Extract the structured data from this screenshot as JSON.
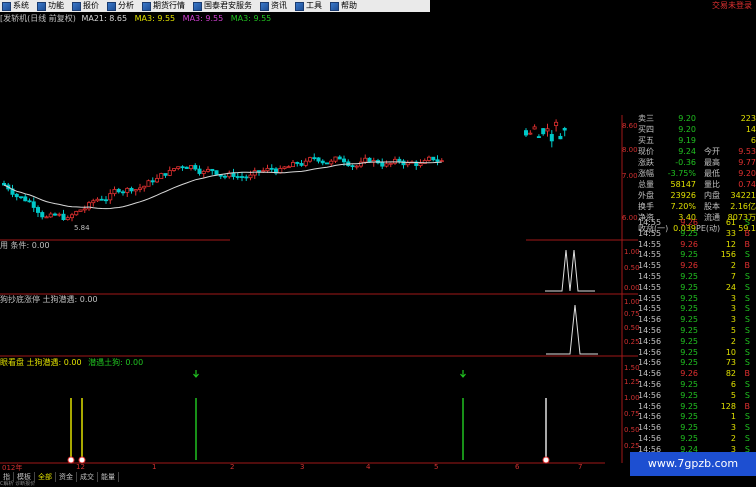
{
  "menu": [
    "系统",
    "功能",
    "报价",
    "分析",
    "期货行情",
    "国泰君安服务",
    "资讯",
    "工具",
    "帮助"
  ],
  "top_right_text": "交易未登录",
  "main_panel": {
    "title": "[发轿机(日线 前复权)",
    "ma21": "MA21: 8.65",
    "ma3a": "MA3: 9.55",
    "ma3b": "MA3: 9.55",
    "ma3c": "MA3: 9.55",
    "low_label": "5.84",
    "yticks": [
      "8.60",
      "8.00",
      "7.00",
      "6.00"
    ]
  },
  "ind1": {
    "label": "用  条件: 0.00",
    "yticks": [
      "1.00",
      "0.50",
      "0.00"
    ]
  },
  "ind2": {
    "label": "狗抄底涨停  土狗潜遇: 0.00",
    "yticks": [
      "1.00",
      "0.75",
      "0.50",
      "0.25"
    ]
  },
  "ind3": {
    "label_a": "眼看盘  土狗潜遇: 0.00",
    "label_b": "潜遇土狗: 0.00",
    "yticks": [
      "1.50",
      "1.25",
      "1.00",
      "0.75",
      "0.50",
      "0.25"
    ]
  },
  "xaxis": [
    "012年",
    "12",
    "1",
    "2",
    "3",
    "4",
    "5",
    "6",
    "7"
  ],
  "quote": [
    {
      "l": "卖三",
      "v": "9.20",
      "r": "223"
    },
    {
      "l": "买四",
      "v": "9.20",
      "r": "14"
    },
    {
      "l": "买五",
      "v": "9.19",
      "r": "6"
    },
    {
      "l": "现价",
      "v": "9.24",
      "l2": "今开",
      "v2": "9.53"
    },
    {
      "l": "涨跌",
      "v": "-0.36",
      "l2": "最高",
      "v2": "9.77"
    },
    {
      "l": "涨幅",
      "v": "-3.75%",
      "l2": "最低",
      "v2": "9.20"
    },
    {
      "l": "总量",
      "v": "58147",
      "l2": "量比",
      "v2": "0.74"
    },
    {
      "l": "外盘",
      "v": "23926",
      "l2": "内盘",
      "v2": "34221"
    },
    {
      "l": "换手",
      "v": "7.20%",
      "l2": "股本",
      "v2": "2.16亿"
    },
    {
      "l": "净资",
      "v": "3.40",
      "l2": "流通",
      "v2": "8073万"
    },
    {
      "l": "收益(一)",
      "v": "0.039",
      "l2": "PE(动)",
      "v2": "59.1"
    }
  ],
  "ticks": [
    {
      "t": "14:55",
      "p": "9.26",
      "v": "61",
      "d": "S"
    },
    {
      "t": "14:55",
      "p": "9.25",
      "v": "33",
      "d": "B"
    },
    {
      "t": "14:55",
      "p": "9.26",
      "v": "12",
      "d": "B"
    },
    {
      "t": "14:55",
      "p": "9.25",
      "v": "156",
      "d": "S"
    },
    {
      "t": "14:55",
      "p": "9.26",
      "v": "2",
      "d": "B"
    },
    {
      "t": "14:55",
      "p": "9.25",
      "v": "7",
      "d": "S"
    },
    {
      "t": "14:55",
      "p": "9.25",
      "v": "24",
      "d": "S"
    },
    {
      "t": "14:55",
      "p": "9.25",
      "v": "3",
      "d": "S"
    },
    {
      "t": "14:55",
      "p": "9.25",
      "v": "3",
      "d": "S"
    },
    {
      "t": "14:56",
      "p": "9.25",
      "v": "3",
      "d": "S"
    },
    {
      "t": "14:56",
      "p": "9.25",
      "v": "5",
      "d": "S"
    },
    {
      "t": "14:56",
      "p": "9.25",
      "v": "2",
      "d": "S"
    },
    {
      "t": "14:56",
      "p": "9.25",
      "v": "10",
      "d": "S"
    },
    {
      "t": "14:56",
      "p": "9.25",
      "v": "73",
      "d": "S"
    },
    {
      "t": "14:56",
      "p": "9.26",
      "v": "82",
      "d": "B"
    },
    {
      "t": "14:56",
      "p": "9.25",
      "v": "6",
      "d": "S"
    },
    {
      "t": "14:56",
      "p": "9.25",
      "v": "5",
      "d": "S"
    },
    {
      "t": "14:56",
      "p": "9.25",
      "v": "128",
      "d": "B"
    },
    {
      "t": "14:56",
      "p": "9.25",
      "v": "1",
      "d": "S"
    },
    {
      "t": "14:56",
      "p": "9.25",
      "v": "3",
      "d": "S"
    },
    {
      "t": "14:56",
      "p": "9.25",
      "v": "2",
      "d": "S"
    },
    {
      "t": "14:56",
      "p": "9.24",
      "v": "3",
      "d": "S"
    }
  ],
  "bottom_tabs": [
    "指",
    "模板",
    "全部",
    "资金",
    "成交",
    "能量"
  ],
  "bottom_status": "C解析  诊断报价",
  "watermark": "www.7gpzb.com",
  "colors": {
    "up": "#e03030",
    "down": "#00c8c8",
    "ma": "#d8d8d8",
    "axis": "#a01818",
    "green": "#20c020",
    "yellow": "#e0e000"
  }
}
